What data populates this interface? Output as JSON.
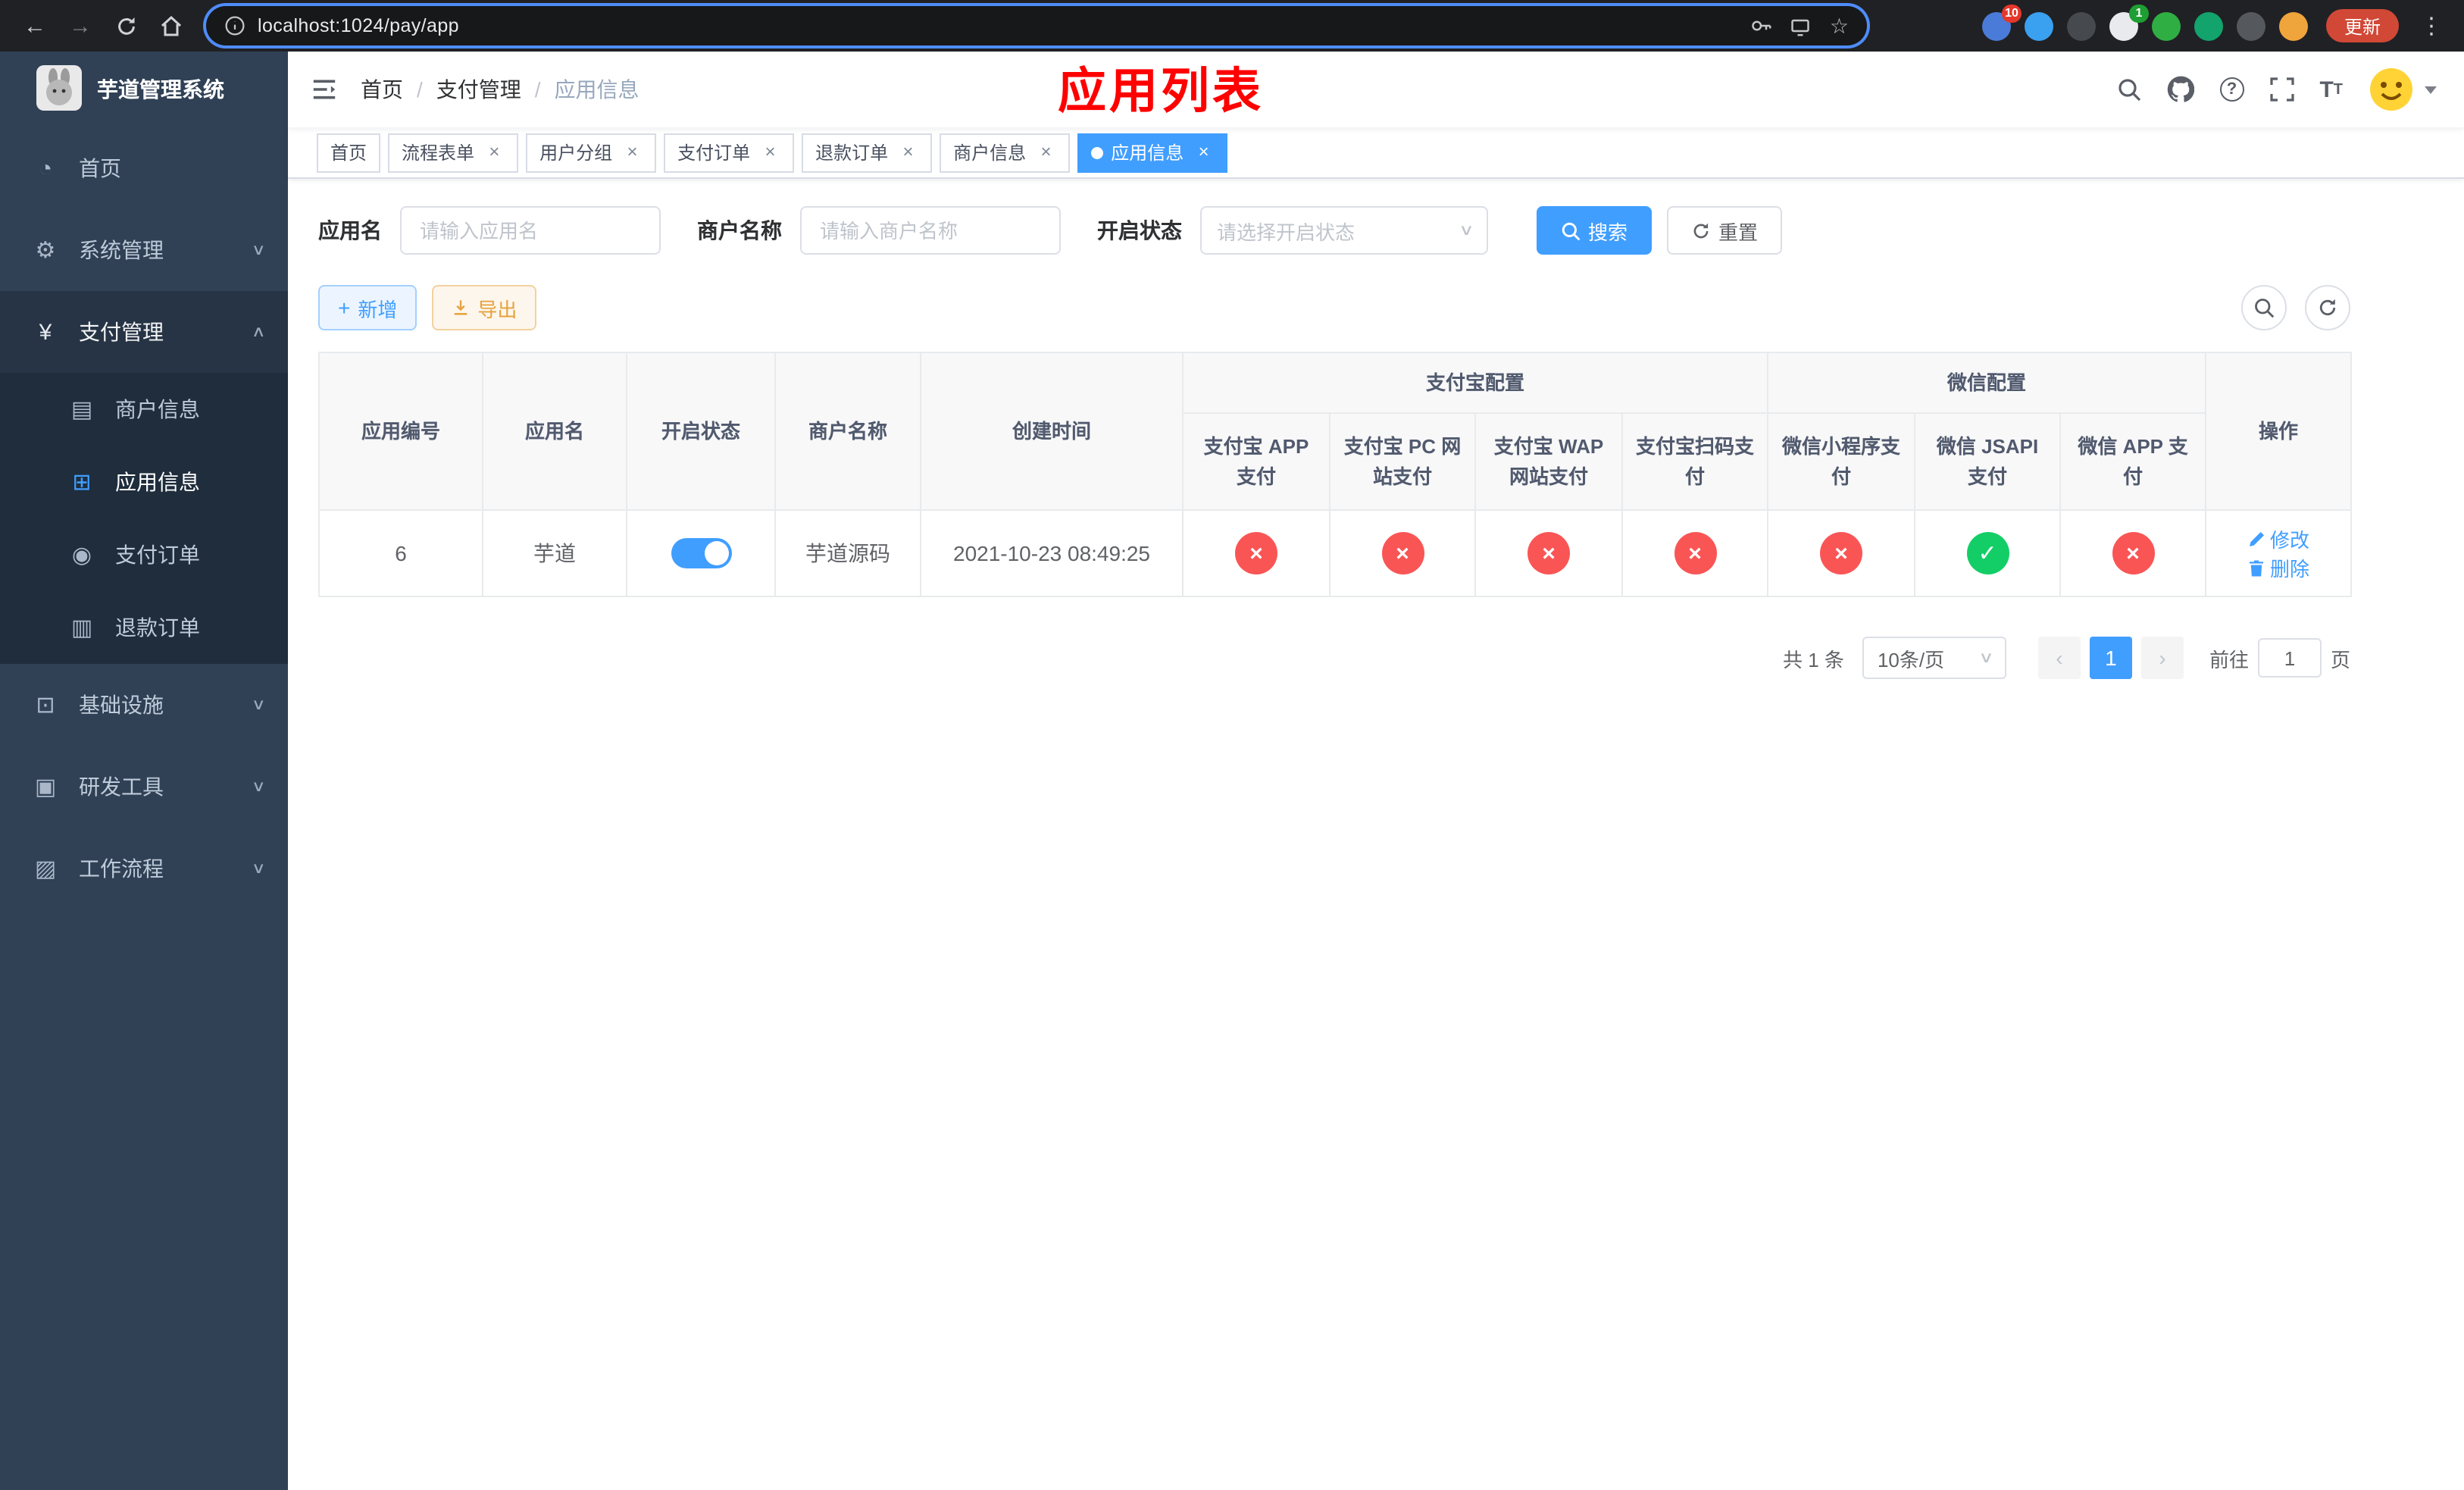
{
  "browser": {
    "url": "localhost:1024/pay/app",
    "update_label": "更新",
    "extensions": [
      {
        "name": "extension-icon-1",
        "color": "#4a7bd8",
        "badge": "10",
        "badge_color": "#e5372c"
      },
      {
        "name": "extension-icon-2",
        "color": "#3aa0f0"
      },
      {
        "name": "extension-icon-3",
        "color": "#46494d"
      },
      {
        "name": "extension-icon-4",
        "color": "#e8eaed",
        "badge": "1",
        "badge_color": "#1e9e33"
      },
      {
        "name": "extension-icon-5",
        "color": "#2fae43"
      },
      {
        "name": "extension-icon-6",
        "color": "#13a36c"
      },
      {
        "name": "extension-icon-7",
        "color": "#55585c"
      },
      {
        "name": "profile-avatar",
        "color": "#f0a43c"
      }
    ]
  },
  "sidebar": {
    "title": "芋道管理系统",
    "items": [
      {
        "label": "首页",
        "icon": "dashboard"
      },
      {
        "label": "系统管理",
        "icon": "gear",
        "expandable": true
      },
      {
        "label": "支付管理",
        "icon": "yen",
        "expandable": true,
        "expanded": true,
        "children": [
          {
            "label": "商户信息",
            "icon": "card"
          },
          {
            "label": "应用信息",
            "icon": "grid",
            "active": true
          },
          {
            "label": "支付订单",
            "icon": "order"
          },
          {
            "label": "退款订单",
            "icon": "doc"
          }
        ]
      },
      {
        "label": "基础设施",
        "icon": "monitor",
        "expandable": true
      },
      {
        "label": "研发工具",
        "icon": "tool",
        "expandable": true
      },
      {
        "label": "工作流程",
        "icon": "flow",
        "expandable": true
      }
    ]
  },
  "header": {
    "breadcrumb": [
      "首页",
      "支付管理",
      "应用信息"
    ],
    "page_title": "应用列表",
    "title_color": "#ff0000"
  },
  "tabs": [
    {
      "label": "首页",
      "closable": false
    },
    {
      "label": "流程表单",
      "closable": true
    },
    {
      "label": "用户分组",
      "closable": true
    },
    {
      "label": "支付订单",
      "closable": true
    },
    {
      "label": "退款订单",
      "closable": true
    },
    {
      "label": "商户信息",
      "closable": true
    },
    {
      "label": "应用信息",
      "closable": true,
      "active": true
    }
  ],
  "filters": {
    "app_name_label": "应用名",
    "app_name_placeholder": "请输入应用名",
    "merchant_label": "商户名称",
    "merchant_placeholder": "请输入商户名称",
    "status_label": "开启状态",
    "status_placeholder": "请选择开启状态",
    "search_button": "搜索",
    "reset_button": "重置"
  },
  "toolbar": {
    "add_button": "新增",
    "export_button": "导出"
  },
  "table": {
    "group_headers": {
      "alipay": "支付宝配置",
      "wechat": "微信配置"
    },
    "columns": [
      "应用编号",
      "应用名",
      "开启状态",
      "商户名称",
      "创建时间",
      "支付宝 APP 支付",
      "支付宝 PC 网站支付",
      "支付宝 WAP 网站支付",
      "支付宝扫码支付",
      "微信小程序支付",
      "微信 JSAPI 支付",
      "微信 APP 支付",
      "操作"
    ],
    "rows": [
      {
        "id": "6",
        "app_name": "芋道",
        "status_on": true,
        "merchant": "芋道源码",
        "created": "2021-10-23 08:49:25",
        "configs": {
          "alipay_app": false,
          "alipay_pc": false,
          "alipay_wap": false,
          "alipay_qr": false,
          "wx_mini": false,
          "wx_jsapi": true,
          "wx_app": false
        },
        "actions": [
          "修改",
          "删除"
        ]
      }
    ]
  },
  "pagination": {
    "total": "共 1 条",
    "page_size": "10条/页",
    "current_page": "1",
    "goto_label": "前往",
    "goto_value": "1",
    "page_suffix": "页"
  },
  "colors": {
    "accent": "#409eff",
    "success": "#13ce66",
    "danger": "#fa5555",
    "warning": "#e6a23c",
    "sidebar_bg": "#304156",
    "submenu_bg": "#1f2d3d",
    "title_red": "#ff0000",
    "update_button_red": "#d14836"
  }
}
